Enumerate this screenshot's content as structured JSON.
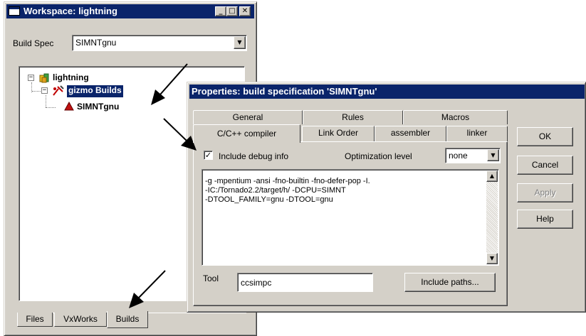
{
  "workspace": {
    "title": "Workspace: lightning",
    "build_spec_label": "Build Spec",
    "build_spec_value": "SIMNTgnu",
    "tree": {
      "root": "lightning",
      "child": "gizmo Builds",
      "leaf": "SIMNTgnu"
    },
    "tabs": [
      "Files",
      "VxWorks",
      "Builds"
    ],
    "active_tab": "Builds"
  },
  "dialog": {
    "title": "Properties: build specification 'SIMNTgnu'",
    "tabs_back": [
      "General",
      "Rules",
      "Macros"
    ],
    "tabs_front": [
      "C/C++ compiler",
      "Link Order",
      "assembler",
      "linker"
    ],
    "active_tab": "C/C++ compiler",
    "include_debug_label": "Include debug info",
    "include_debug_checked": true,
    "optimization_label": "Optimization level",
    "optimization_value": "none",
    "command_lines": [
      "-g -mpentium -ansi -fno-builtin -fno-defer-pop -I.",
      "-IC:/Tornado2.2/target/h/ -DCPU=SIMNT",
      "-DTOOL_FAMILY=gnu -DTOOL=gnu"
    ],
    "tool_label": "Tool",
    "tool_value": "ccsimpc",
    "include_paths_button": "Include paths...",
    "buttons": {
      "ok": "OK",
      "cancel": "Cancel",
      "apply": "Apply",
      "help": "Help"
    }
  },
  "colors": {
    "titlebar": "#0a246a",
    "face": "#d4d0c8",
    "selection": "#0a246a"
  }
}
